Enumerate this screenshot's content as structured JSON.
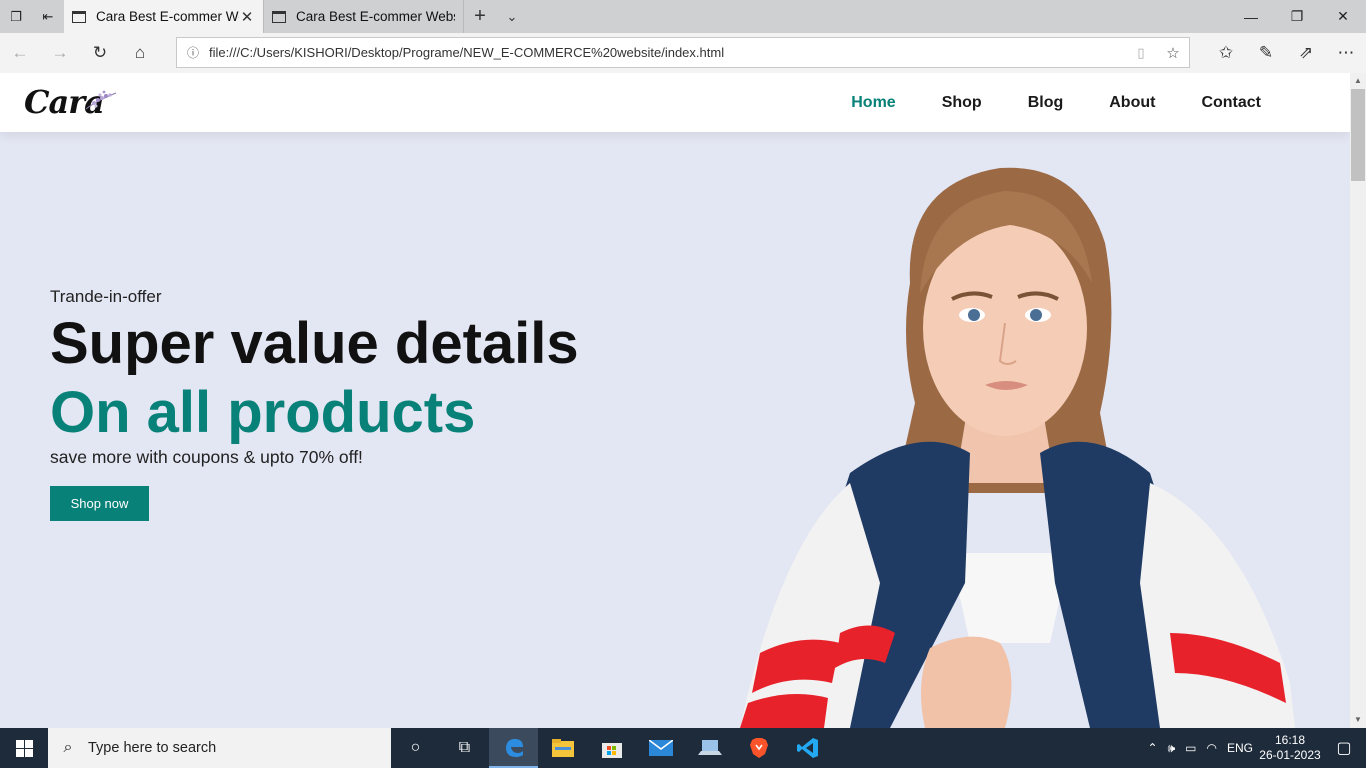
{
  "browser": {
    "tabs": [
      {
        "title": "Cara Best E-commer We",
        "active": true
      },
      {
        "title": "Cara Best E-commer Websit",
        "active": false
      }
    ],
    "url": "file:///C:/Users/KISHORI/Desktop/Programe/NEW_E-COMMERCE%20website/index.html"
  },
  "site": {
    "logo": "Cara",
    "nav": [
      "Home",
      "Shop",
      "Blog",
      "About",
      "Contact"
    ],
    "active_nav": "Home",
    "hero": {
      "kicker": "Trande-in-offer",
      "title": "Super value details",
      "title_accent": "On all products",
      "subtitle": "save more with coupons & upto 70% off!",
      "cta": "Shop now"
    },
    "colors": {
      "accent": "#088178",
      "hero_bg": "#e3e6f3"
    }
  },
  "taskbar": {
    "search_placeholder": "Type here to search",
    "language": "ENG",
    "time": "16:18",
    "date": "26-01-2023"
  }
}
